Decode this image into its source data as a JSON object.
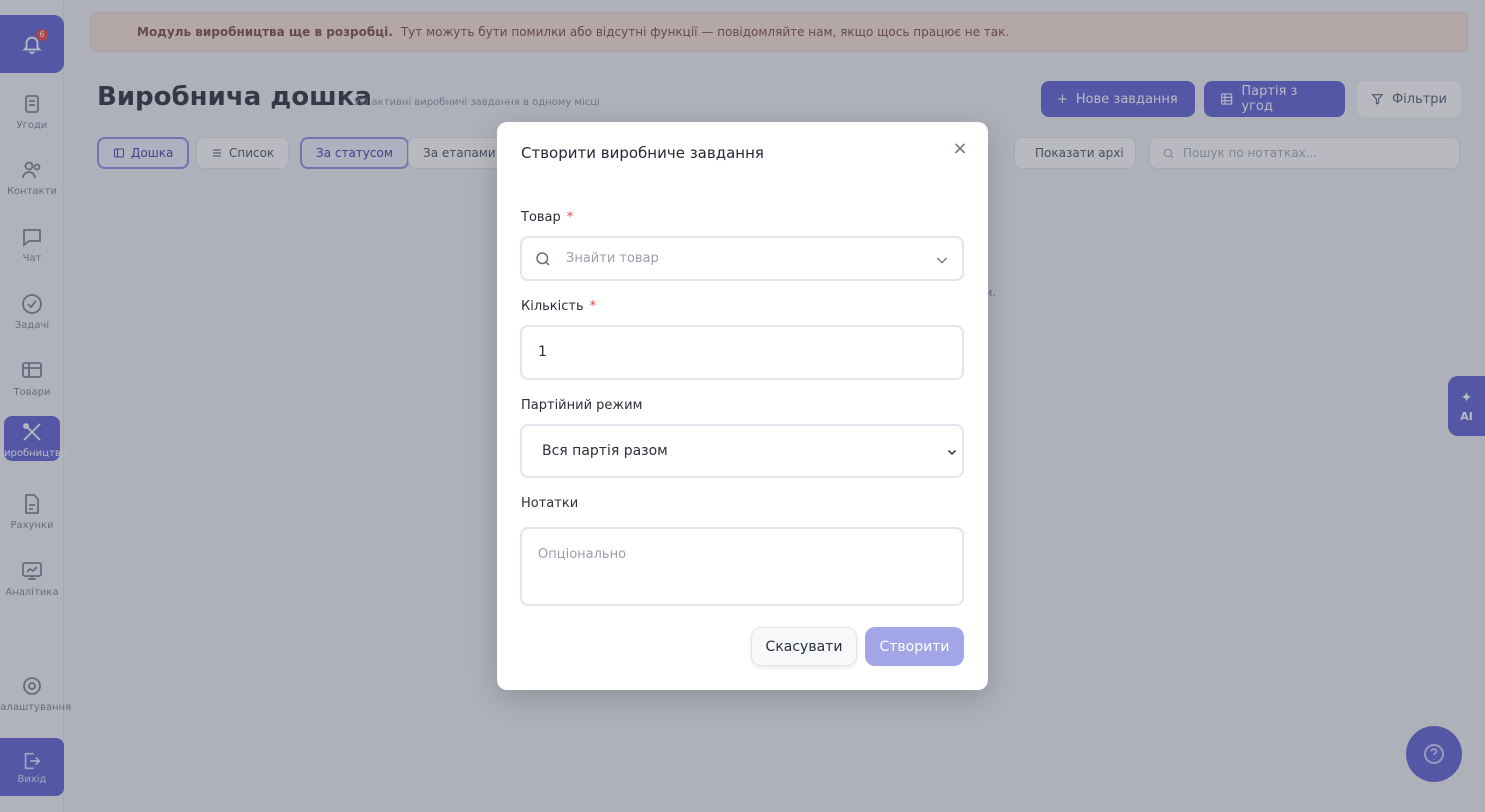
{
  "sidebar": {
    "notification_count": "6",
    "items": [
      {
        "label": "Угоди",
        "icon": "deals-icon"
      },
      {
        "label": "Контакти",
        "icon": "contacts-icon"
      },
      {
        "label": "Чат",
        "icon": "chat-icon"
      },
      {
        "label": "Задачі",
        "icon": "tasks-icon"
      },
      {
        "label": "Товари",
        "icon": "products-icon"
      },
      {
        "label": "Виробництво",
        "icon": "production-icon"
      },
      {
        "label": "Рахунки",
        "icon": "invoices-icon"
      },
      {
        "label": "Аналітика",
        "icon": "analytics-icon"
      },
      {
        "label": "Налаштування",
        "icon": "settings-icon"
      }
    ],
    "exit_label": "Вихід"
  },
  "banner": {
    "bold": "Модуль виробництва ще в розробці.",
    "text": "Тут можуть бути помилки або відсутні функції — повідомляйте нам, якщо щось працює не так."
  },
  "header": {
    "title": "Виробнича дошка",
    "subtitle": "Усі активні виробничі завдання в одному місці",
    "new_task": "Нове завдання",
    "batch_from_deals": "Партія з угод",
    "filters": "Фільтри"
  },
  "tabs": {
    "board": "Дошка",
    "list": "Список",
    "by_status": "За статусом",
    "by_stage": "За етапами",
    "show_archive": "Показати архі",
    "search_placeholder": "Пошук по нотатках..."
  },
  "background_text": "м.",
  "ai_label": "AI",
  "modal": {
    "title": "Створити виробниче завдання",
    "product_label": "Товар",
    "product_placeholder": "Знайти товар",
    "quantity_label": "Кількість",
    "quantity_value": "1",
    "mode_label": "Партійний режим",
    "mode_value": "Вся партія разом",
    "notes_label": "Нотатки",
    "notes_placeholder": "Опціонально",
    "required_mark": "*",
    "cancel": "Скасувати",
    "create": "Створити"
  },
  "colors": {
    "accent": "#5b5fd6",
    "accent_disabled": "#a3a6e6",
    "required": "#e04848"
  }
}
